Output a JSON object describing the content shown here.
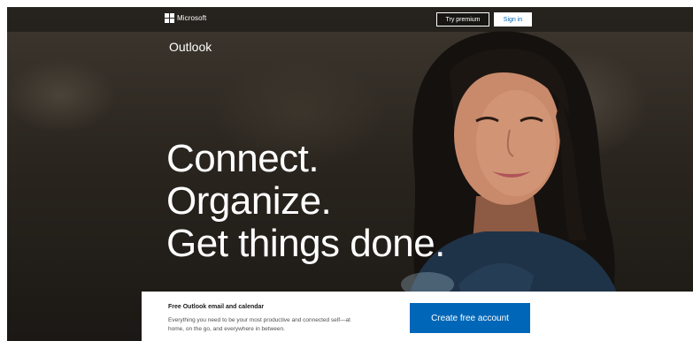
{
  "topbar": {
    "brand": "Microsoft",
    "try_premium": "Try premium",
    "sign_in": "Sign in"
  },
  "product": {
    "name": "Outlook"
  },
  "hero": {
    "lines": [
      "Connect.",
      "Organize.",
      "Get things done."
    ]
  },
  "panel": {
    "title": "Free Outlook email and calendar",
    "description": "Everything you need to be your most productive and connected self—at home, on the go, and everywhere in between.",
    "cta": "Create free account"
  },
  "colors": {
    "accent": "#0067b8",
    "text_light": "#ffffff",
    "panel_bg": "#ffffff"
  },
  "icons": {
    "logo": "microsoft-logo-icon"
  }
}
